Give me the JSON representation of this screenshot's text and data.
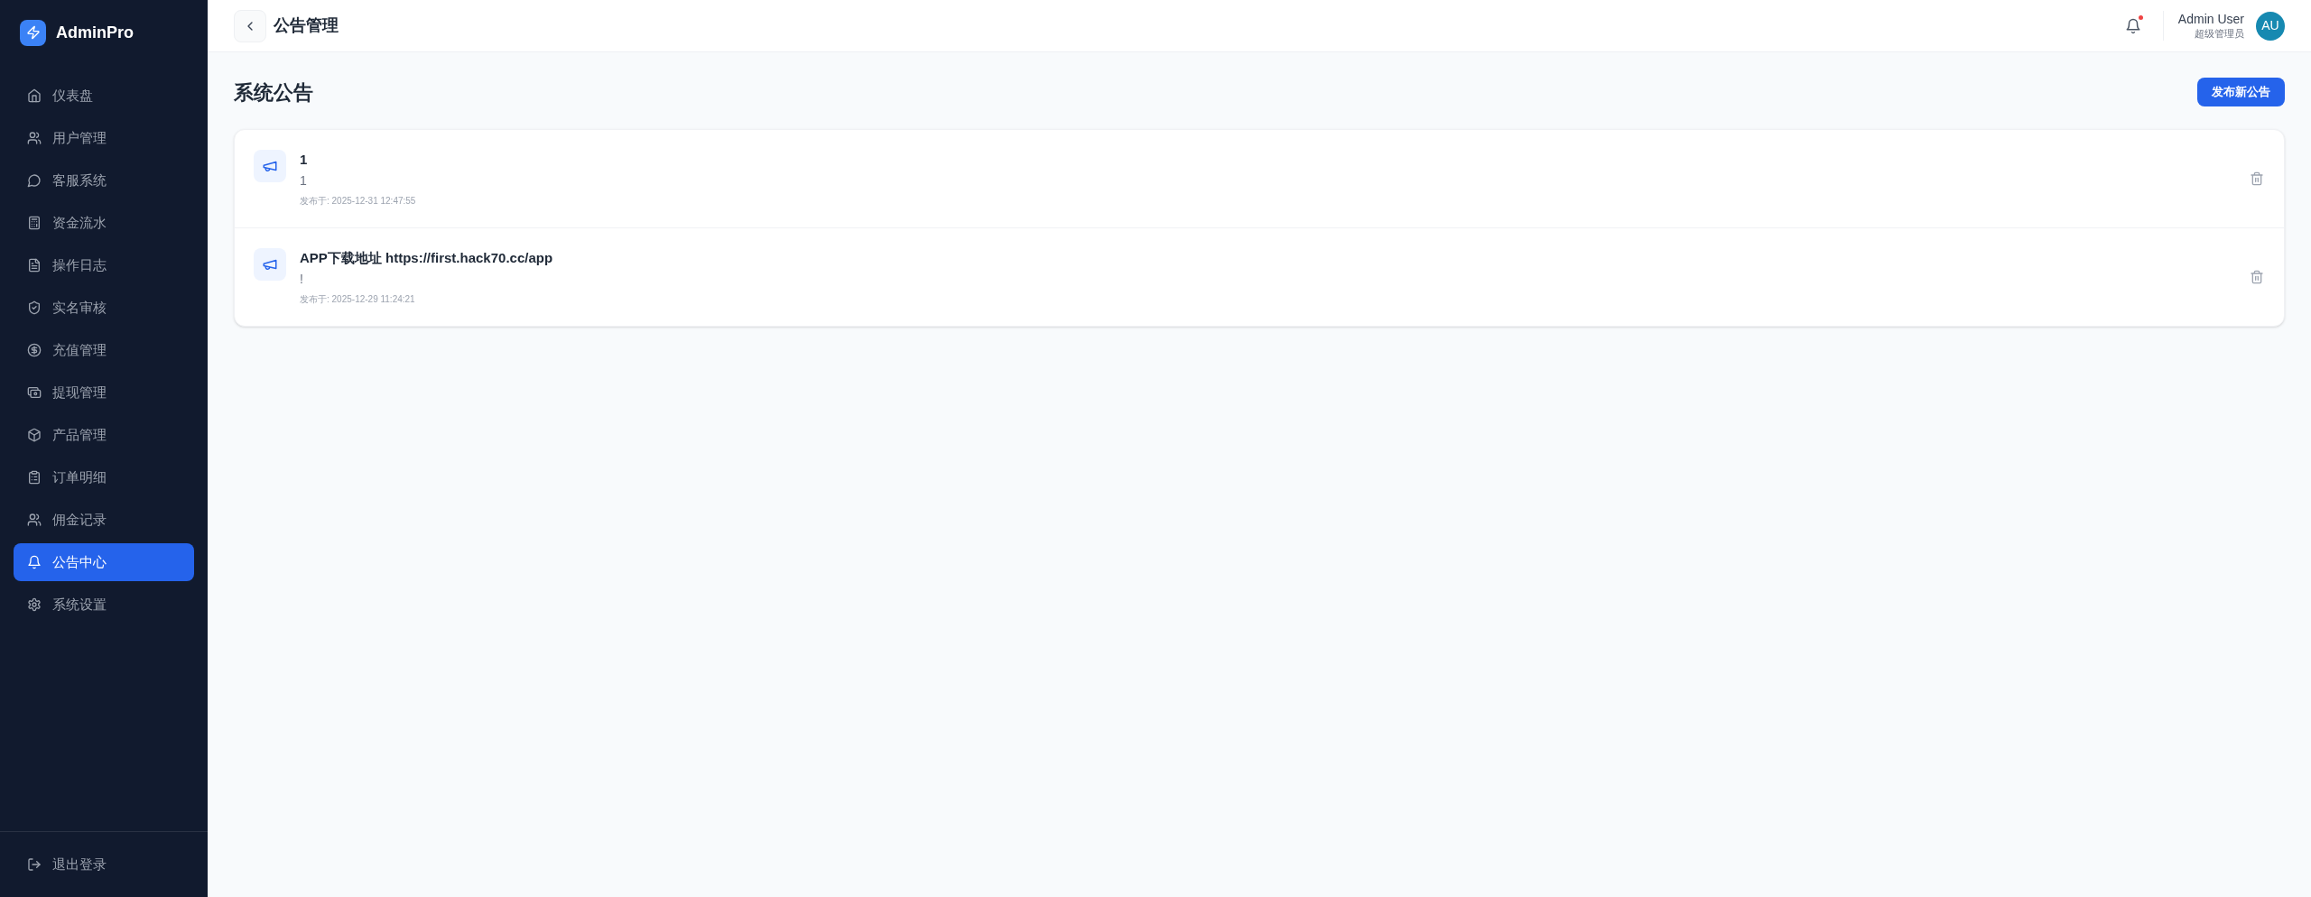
{
  "sidebar": {
    "brand": "AdminPro",
    "items": [
      {
        "label": "仪表盘",
        "selected": false
      },
      {
        "label": "用户管理",
        "selected": false
      },
      {
        "label": "客服系统",
        "selected": false
      },
      {
        "label": "资金流水",
        "selected": false
      },
      {
        "label": "操作日志",
        "selected": false
      },
      {
        "label": "实名审核",
        "selected": false
      },
      {
        "label": "充值管理",
        "selected": false
      },
      {
        "label": "提现管理",
        "selected": false
      },
      {
        "label": "产品管理",
        "selected": false
      },
      {
        "label": "订单明细",
        "selected": false
      },
      {
        "label": "佣金记录",
        "selected": false
      },
      {
        "label": "公告中心",
        "selected": true
      },
      {
        "label": "系统设置",
        "selected": false
      }
    ],
    "logout": "退出登录"
  },
  "header": {
    "title": "公告管理",
    "has_unread_notifications": true,
    "user": {
      "name": "Admin User",
      "role": "超级管理员",
      "initials": "AU"
    }
  },
  "page": {
    "title": "系统公告",
    "publish_button": "发布新公告"
  },
  "announcements": [
    {
      "title": "1",
      "body": "1",
      "published": "发布于: 2025-12-31 12:47:55"
    },
    {
      "title": "APP下载地址 https://first.hack70.cc/app",
      "body": "!",
      "published": "发布于: 2025-12-29 11:24:21"
    }
  ]
}
